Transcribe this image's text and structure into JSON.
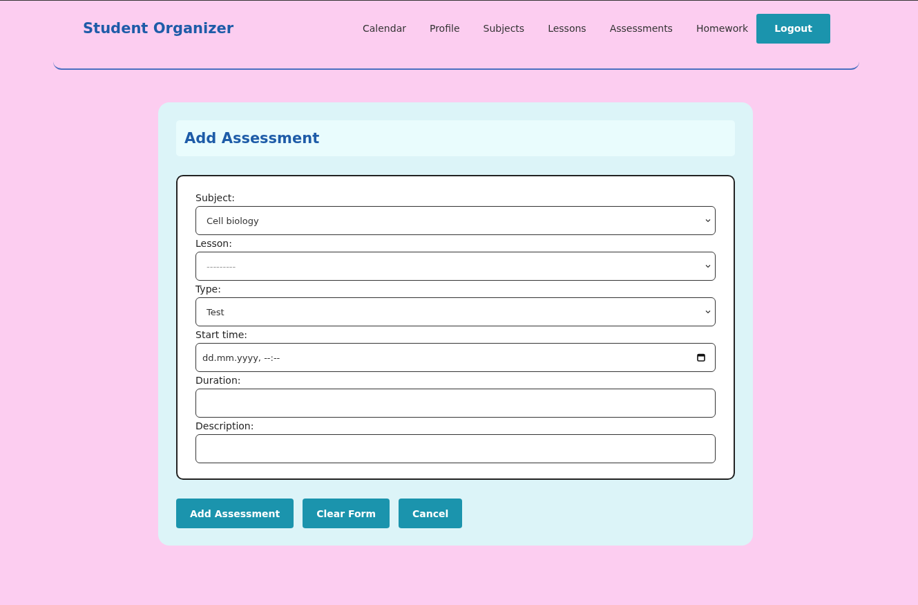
{
  "navbar": {
    "brand": "Student Organizer",
    "links": [
      "Calendar",
      "Profile",
      "Subjects",
      "Lessons",
      "Assessments",
      "Homework"
    ],
    "logout": "Logout"
  },
  "form": {
    "title": "Add Assessment",
    "fields": [
      {
        "label": "Subject:",
        "kind": "select",
        "value": "Cell biology"
      },
      {
        "label": "Lesson:",
        "kind": "select",
        "placeholder": "---------"
      },
      {
        "label": "Type:",
        "kind": "select",
        "value": "Test"
      },
      {
        "label": "Start time:",
        "kind": "datetime",
        "placeholder": "dd.mm.yyyy, --:--"
      },
      {
        "label": "Duration:",
        "kind": "text"
      },
      {
        "label": "Description:",
        "kind": "text"
      }
    ],
    "buttons": [
      "Add Assessment",
      "Clear Form",
      "Cancel"
    ]
  }
}
